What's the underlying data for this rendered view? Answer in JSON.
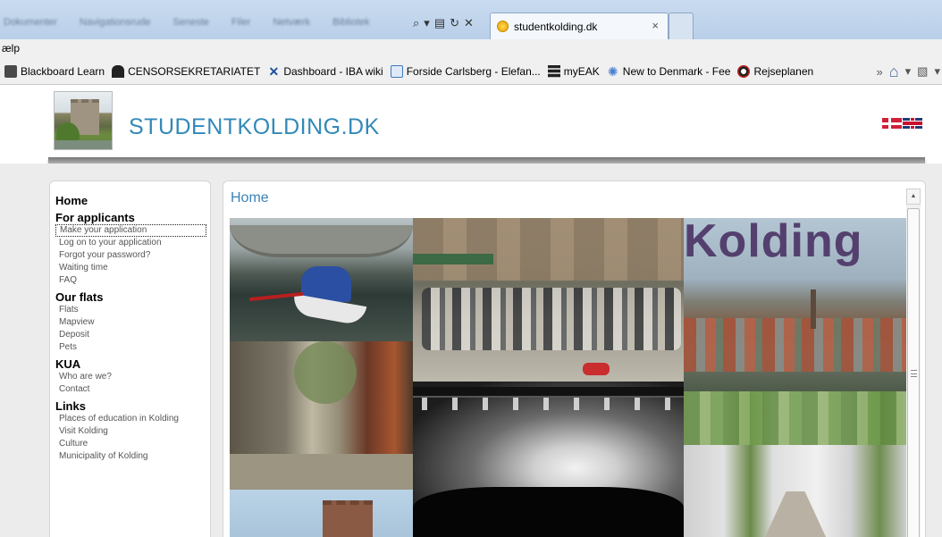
{
  "browser": {
    "blurred_tabs": [
      "Dokumenter",
      "Navigationsrude",
      "Seneste",
      "Filer",
      "Netværk",
      "Bibliotek"
    ],
    "address_icons": [
      "search-icon",
      "dropdown-icon",
      "compat-icon",
      "refresh-icon",
      "stop-icon"
    ],
    "address_glyphs": [
      "⌕",
      "▾",
      "▤",
      "↻",
      "✕"
    ],
    "active_tab": {
      "title": "studentkolding.dk",
      "close": "×"
    },
    "menu": {
      "help": "ælp"
    },
    "favorites": [
      {
        "label": "Blackboard Learn",
        "icon": "blackboard-icon",
        "color": "#333333"
      },
      {
        "label": "CENSORSEKRETARIATET",
        "icon": "censor-icon",
        "color": "#1a1a1a"
      },
      {
        "label": "Dashboard - IBA wiki",
        "icon": "wiki-icon",
        "color": "#1f4fa0"
      },
      {
        "label": "Forside  Carlsberg - Elefan...",
        "icon": "ie-page-icon",
        "color": "#3a7ac2"
      },
      {
        "label": "myEAK",
        "icon": "myeak-icon",
        "color": "#333333"
      },
      {
        "label": "New to Denmark - Fee",
        "icon": "gear-sun-icon",
        "color": "#4a7fd0"
      },
      {
        "label": "Rejseplanen",
        "icon": "rejseplanen-icon",
        "color": "#c02020"
      }
    ],
    "fav_tools": {
      "more": "»",
      "home": "⌂",
      "dropdown": "▾",
      "feed": "▧",
      "feed_dropdown": "▾"
    }
  },
  "site": {
    "title": "STUDENTKOLDING.DK",
    "accent": "#3289b8",
    "languages": [
      "Danish",
      "English"
    ]
  },
  "sidebar": {
    "sections": [
      {
        "title": "Home",
        "items": []
      },
      {
        "title": "For applicants",
        "items": [
          "Make your application",
          "Log on to your application",
          "Forgot your password?",
          "Waiting time",
          "FAQ"
        ]
      },
      {
        "title": "Our flats",
        "items": [
          "Flats",
          "Mapview",
          "Deposit",
          "Pets"
        ]
      },
      {
        "title": "KUA",
        "items": [
          "Who are we?",
          "Contact"
        ]
      },
      {
        "title": "Links",
        "items": [
          "Places of education in Kolding",
          "Visit Kolding",
          "Culture",
          "Municipality of Kolding"
        ]
      }
    ],
    "selected_item": "Make your application"
  },
  "main": {
    "title": "Home",
    "collage": {
      "kolding_word": "Kolding"
    },
    "scroll_up": "▲"
  }
}
